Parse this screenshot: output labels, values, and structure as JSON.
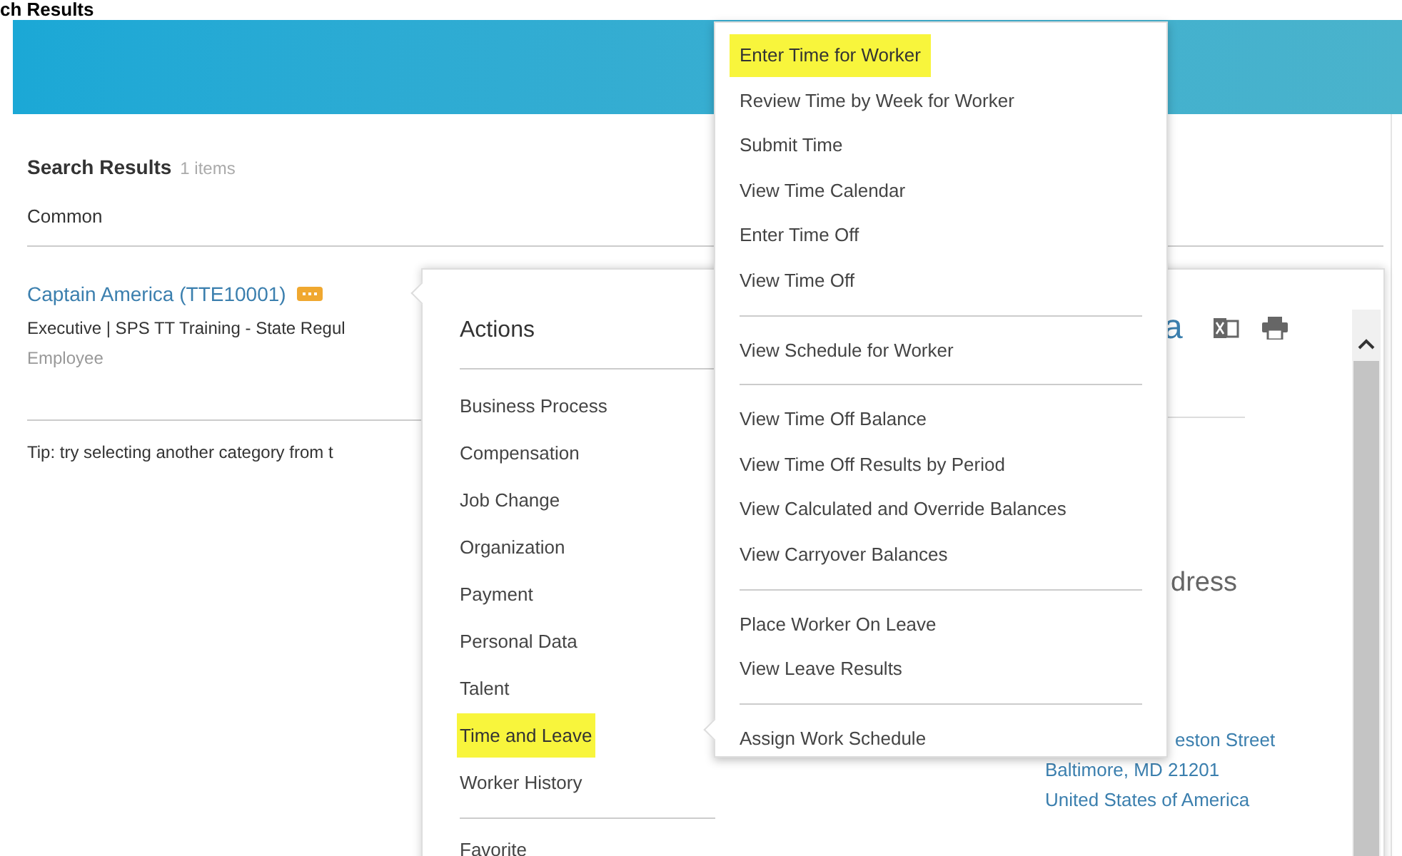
{
  "page_title": "ch Results",
  "search_results": {
    "title": "Search Results",
    "count": "1 items",
    "category": "Common",
    "result": {
      "name": "Captain America (TTE10001)",
      "detail": "Executive | SPS TT Training - State Regul",
      "type": "Employee"
    },
    "tip": "Tip: try selecting another category from t"
  },
  "actions_panel": {
    "title": "Actions",
    "items": [
      {
        "label": "Business Process",
        "highlighted": false
      },
      {
        "label": "Compensation",
        "highlighted": false
      },
      {
        "label": "Job Change",
        "highlighted": false
      },
      {
        "label": "Organization",
        "highlighted": false
      },
      {
        "label": "Payment",
        "highlighted": false
      },
      {
        "label": "Personal Data",
        "highlighted": false
      },
      {
        "label": "Talent",
        "highlighted": false
      },
      {
        "label": "Time and Leave",
        "highlighted": true
      },
      {
        "label": "Worker History",
        "highlighted": false
      }
    ],
    "footer_item": "Favorite"
  },
  "worker_preview": {
    "name": "a",
    "address_heading": "dress",
    "address_lines": [
      "eston Street",
      "Baltimore, MD 21201",
      "United States of America"
    ]
  },
  "submenu": {
    "groups": [
      [
        {
          "label": "Enter Time for Worker",
          "highlighted": true
        },
        {
          "label": "Review Time by Week for Worker",
          "highlighted": false
        },
        {
          "label": "Submit Time",
          "highlighted": false
        },
        {
          "label": "View Time Calendar",
          "highlighted": false
        },
        {
          "label": "Enter Time Off",
          "highlighted": false
        },
        {
          "label": "View Time Off",
          "highlighted": false
        }
      ],
      [
        {
          "label": "View Schedule for Worker",
          "highlighted": false
        }
      ],
      [
        {
          "label": "View Time Off Balance",
          "highlighted": false
        },
        {
          "label": "View Time Off Results by Period",
          "highlighted": false
        },
        {
          "label": "View Calculated and Override Balances",
          "highlighted": false
        },
        {
          "label": "View Carryover Balances",
          "highlighted": false
        }
      ],
      [
        {
          "label": "Place Worker On Leave",
          "highlighted": false
        },
        {
          "label": "View Leave Results",
          "highlighted": false
        }
      ],
      [
        {
          "label": "Assign Work Schedule",
          "highlighted": false
        }
      ]
    ]
  }
}
